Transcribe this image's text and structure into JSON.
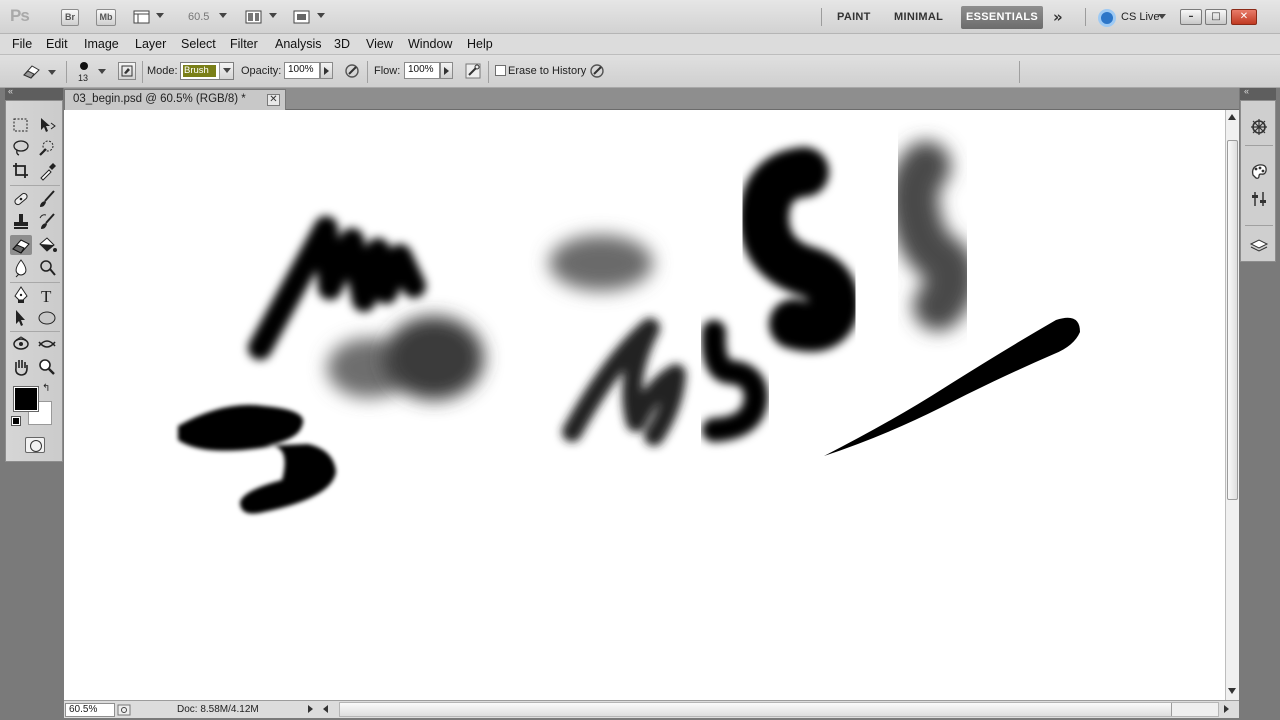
{
  "app": {
    "logo": "Ps"
  },
  "appbar": {
    "bridge_label": "Br",
    "minibridge_label": "Mb",
    "zoom_value": "60.5",
    "workspaces": [
      "PAINT",
      "MINIMAL",
      "ESSENTIALS"
    ],
    "active_workspace": "ESSENTIALS",
    "cs_live": "CS Live"
  },
  "menu": [
    "File",
    "Edit",
    "Image",
    "Layer",
    "Select",
    "Filter",
    "Analysis",
    "3D",
    "View",
    "Window",
    "Help"
  ],
  "options": {
    "brush_size": "13",
    "mode_label": "Mode:",
    "mode_value": "Brush",
    "opacity_label": "Opacity:",
    "opacity_value": "100%",
    "flow_label": "Flow:",
    "flow_value": "100%",
    "erase_history_label": "Erase to History"
  },
  "document": {
    "tab_title": "03_begin.psd @ 60.5% (RGB/8) *"
  },
  "status": {
    "zoom": "60.5%",
    "doc_info": "Doc: 8.58M/4.12M"
  },
  "colors": {
    "foreground": "#000000",
    "background": "#ffffff",
    "accent": "#7a7f18"
  },
  "icons": {
    "active_tool": "eraser-icon",
    "right_dock": [
      "navigator-icon",
      "color-icon",
      "adjustments-icon",
      "layers-icon"
    ]
  }
}
